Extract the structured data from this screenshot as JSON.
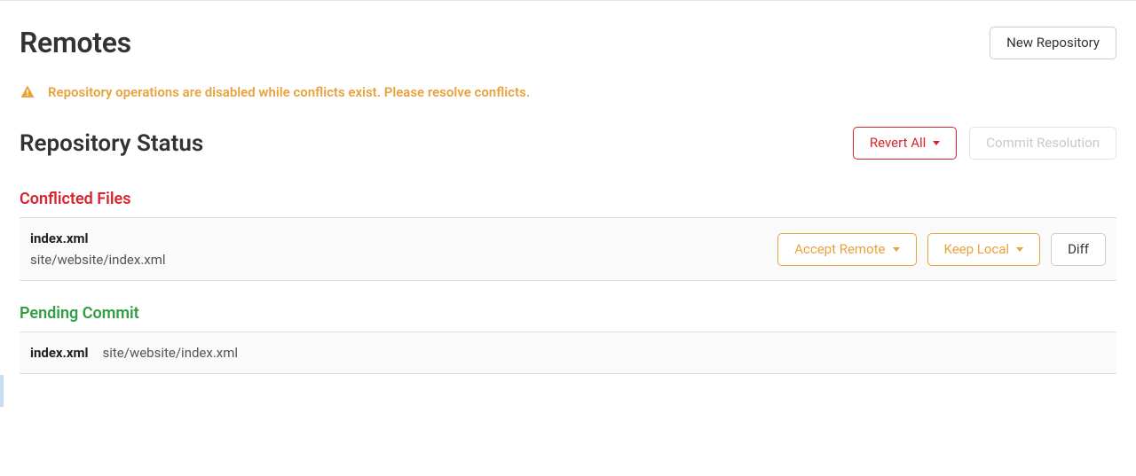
{
  "header": {
    "title": "Remotes",
    "new_repo_label": "New Repository"
  },
  "warning": {
    "message": "Repository operations are disabled while conflicts exist. Please resolve conflicts."
  },
  "status": {
    "title": "Repository Status",
    "revert_all_label": "Revert All",
    "commit_resolution_label": "Commit Resolution"
  },
  "conflicted": {
    "title": "Conflicted Files",
    "rows": [
      {
        "name": "index.xml",
        "path": "site/website/index.xml"
      }
    ],
    "actions": {
      "accept_remote": "Accept Remote",
      "keep_local": "Keep Local",
      "diff": "Diff"
    }
  },
  "pending": {
    "title": "Pending Commit",
    "rows": [
      {
        "name": "index.xml",
        "path": "site/website/index.xml"
      }
    ]
  }
}
